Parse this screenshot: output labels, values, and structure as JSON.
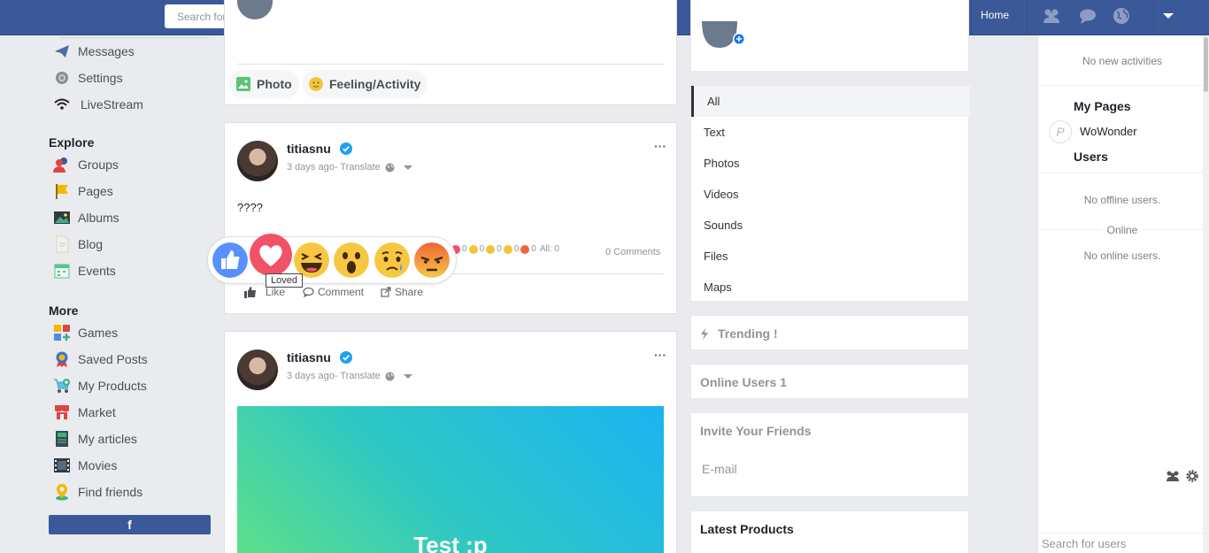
{
  "header": {
    "search_placeholder": "Search for people, pages, groups and #hashtags",
    "home_label": "Home",
    "icons": [
      "friends-icon",
      "messages-icon",
      "globe-icon",
      "dropdown-caret-icon"
    ]
  },
  "sidebar": {
    "top_items": [
      {
        "label": "Messages",
        "icon": "paper-plane-icon"
      },
      {
        "label": "Settings",
        "icon": "gear-icon"
      },
      {
        "label": "LiveStream",
        "icon": "wifi-icon"
      }
    ],
    "explore_heading": "Explore",
    "explore_items": [
      {
        "label": "Groups",
        "icon": "users-icon"
      },
      {
        "label": "Pages",
        "icon": "flag-icon"
      },
      {
        "label": "Albums",
        "icon": "image-icon"
      },
      {
        "label": "Blog",
        "icon": "document-icon"
      },
      {
        "label": "Events",
        "icon": "calendar-icon"
      }
    ],
    "more_heading": "More",
    "more_items": [
      {
        "label": "Games",
        "icon": "grid-icon"
      },
      {
        "label": "Saved Posts",
        "icon": "ribbon-icon"
      },
      {
        "label": "My Products",
        "icon": "cart-icon"
      },
      {
        "label": "Market",
        "icon": "store-icon"
      },
      {
        "label": "My articles",
        "icon": "book-icon"
      },
      {
        "label": "Movies",
        "icon": "film-icon"
      },
      {
        "label": "Find friends",
        "icon": "map-pin-icon"
      }
    ],
    "facebook_button": "f"
  },
  "composer": {
    "photo_label": "Photo",
    "feeling_label": "Feeling/Activity"
  },
  "posts": [
    {
      "author": "titiasnu",
      "time": "3 days ago",
      "translate": " - Translate",
      "text": "????",
      "reaction_counts": [
        "0",
        "0",
        "0",
        "0",
        "0"
      ],
      "all_label": "All: 0",
      "comments": "0 Comments",
      "actions": {
        "like": "Like",
        "comment": "Comment",
        "share": "Share"
      },
      "tooltip": "Loved"
    },
    {
      "author": "titiasnu",
      "time": "3 days ago",
      "translate": " - Translate",
      "image_text": "Test :p"
    }
  ],
  "filters": [
    "All",
    "Text",
    "Photos",
    "Videos",
    "Sounds",
    "Files",
    "Maps"
  ],
  "widgets": {
    "trending": "Trending !",
    "online_users": "Online Users 1",
    "invite": "Invite Your Friends",
    "email_label": "E-mail",
    "latest_products": "Latest Products"
  },
  "right_sidebar": {
    "no_activities": "No new activities",
    "my_pages": "My Pages",
    "page_name": "WoWonder",
    "page_logo_letter": "P",
    "users_heading": "Users",
    "no_offline": "No offline users.",
    "online_label": "Online",
    "no_online": "No online users.",
    "search_placeholder": "Search for users"
  },
  "colors": {
    "brand": "#3b5998",
    "verified": "#1da1f2",
    "like": "#5890ff",
    "love": "#f25268"
  }
}
